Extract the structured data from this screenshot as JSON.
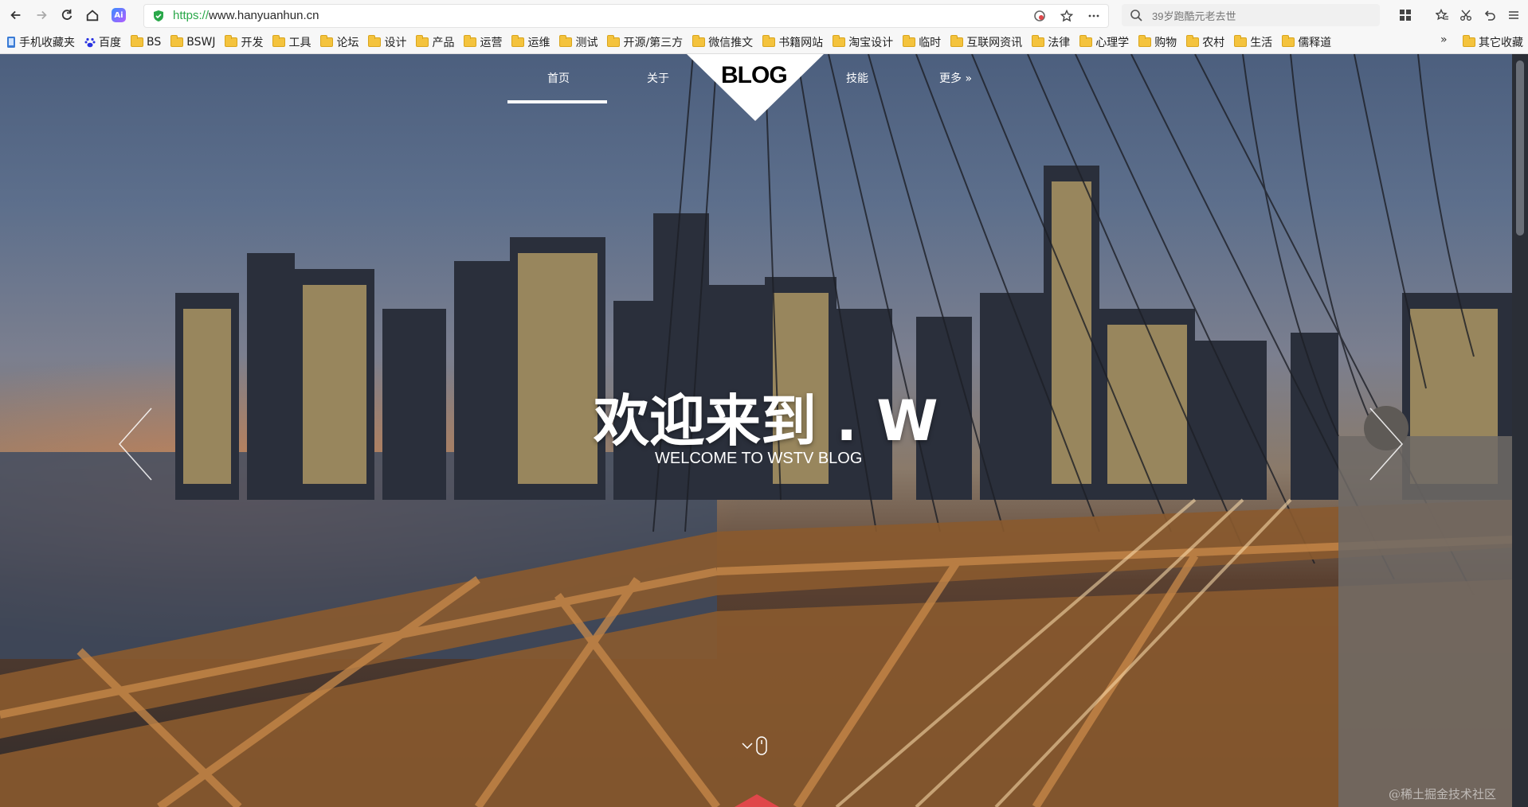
{
  "browser": {
    "url_scheme": "https://",
    "url_host": "www.hanyuanhun.cn",
    "ai_badge": "Ai",
    "search_placeholder": "39岁跑酷元老去世"
  },
  "bookmarks": {
    "mobile_label": "手机收藏夹",
    "baidu_label": "百度",
    "folders": [
      "BS",
      "BSWJ",
      "开发",
      "工具",
      "论坛",
      "设计",
      "产品",
      "运营",
      "运维",
      "测试",
      "开源/第三方",
      "微信推文",
      "书籍网站",
      "淘宝设计",
      "临时",
      "互联网资讯",
      "法律",
      "心理学",
      "购物",
      "农村",
      "生活",
      "儒释道"
    ],
    "overflow": "»",
    "other_label": "其它收藏"
  },
  "site": {
    "nav": {
      "home": "首页",
      "about": "关于",
      "logo": "BLOG",
      "skills": "技能",
      "more": "更多 »"
    },
    "hero_title": "欢迎来到 . W",
    "hero_subtitle": "WELCOME TO WSTV BLOG",
    "watermark": "@稀土掘金技术社区"
  },
  "colors": {
    "accent_red": "#e0474a",
    "secure_green": "#2aa84a"
  }
}
